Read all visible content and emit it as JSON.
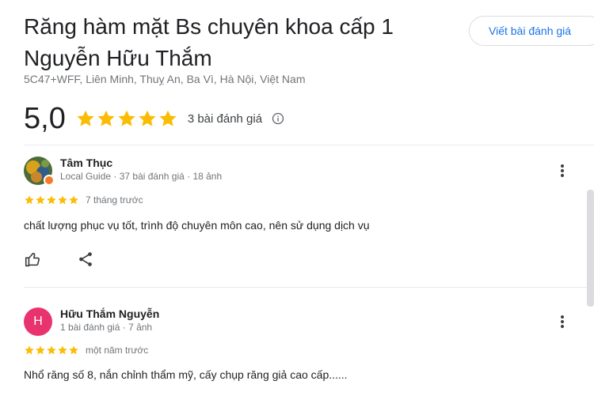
{
  "place": {
    "title": "Răng hàm mặt Bs chuyên khoa cấp 1 Nguyễn Hữu Thắm",
    "address": "5C47+WFF, Liên Minh, Thuỵ An, Ba Vì, Hà Nội, Việt Nam",
    "write_review_label": "Viết bài đánh giá",
    "rating": "5,0",
    "stars": 5,
    "review_count": "3 bài đánh giá"
  },
  "reviews": [
    {
      "name": "Tâm Thục",
      "meta": "Local Guide · 37 bài đánh giá · 18 ảnh",
      "stars": 5,
      "time": "7 tháng trước",
      "text": "chất lượng phục vụ tốt, trình độ chuyên môn cao, nên sử dụng dịch vụ"
    },
    {
      "name": "Hữu Thắm Nguyễn",
      "initial": "H",
      "meta": "1 bài đánh giá · 7 ảnh",
      "stars": 5,
      "time": "một năm trước",
      "text": "Nhổ răng số 8, nắn chỉnh thẩm mỹ, cấy chụp răng giả cao cấp......"
    }
  ],
  "colors": {
    "star": "#fbbc04",
    "accent": "#1a73e8",
    "avatar_h": "#e8336e"
  },
  "icons": [
    "info-icon",
    "star-icon",
    "more-vert-icon",
    "thumb-up-icon",
    "share-icon"
  ]
}
